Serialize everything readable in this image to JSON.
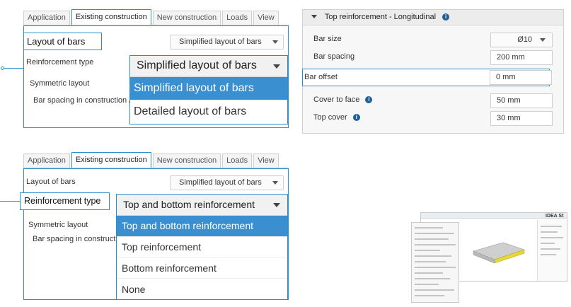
{
  "tabs": [
    "Application",
    "Existing construction",
    "New construction",
    "Loads",
    "View"
  ],
  "panel1": {
    "layout_label": "Layout of bars",
    "layout_value": "Simplified layout of bars",
    "reinforcement_type_label": "Reinforcement type",
    "symmetric_label": "Symmetric layout",
    "spacing_label": "Bar spacing in construction /",
    "dropdown": {
      "selected": "Simplified layout of bars",
      "options": [
        "Simplified layout of bars",
        "Detailed layout of bars"
      ]
    }
  },
  "panel2": {
    "layout_label": "Layout of bars",
    "layout_value": "Simplified layout of bars",
    "reinforcement_type_label": "Reinforcement type",
    "symmetric_label": "Symmetric layout",
    "spacing_label": "Bar spacing in constructio",
    "dropdown": {
      "selected": "Top and bottom reinforcement",
      "options": [
        "Top and bottom reinforcement",
        "Top reinforcement",
        "Bottom reinforcement",
        "None"
      ]
    }
  },
  "reinforcement_panel": {
    "title": "Top reinforcement - Longitudinal",
    "bar_size_label": "Bar size",
    "bar_size_value": "Ø10",
    "bar_spacing_label": "Bar spacing",
    "bar_spacing_value": "200 mm",
    "bar_offset_label": "Bar offset",
    "bar_offset_value": "0 mm",
    "cover_face_label": "Cover to face",
    "cover_face_value": "50 mm",
    "top_cover_label": "Top cover",
    "top_cover_value": "30 mm"
  },
  "thumbnail": {
    "brand_text": "IDEA St"
  },
  "colors": {
    "accent": "#2a8fc9",
    "selection": "#3a8fd0",
    "slab": "#c8c8c8",
    "edge": "#e8d836"
  }
}
